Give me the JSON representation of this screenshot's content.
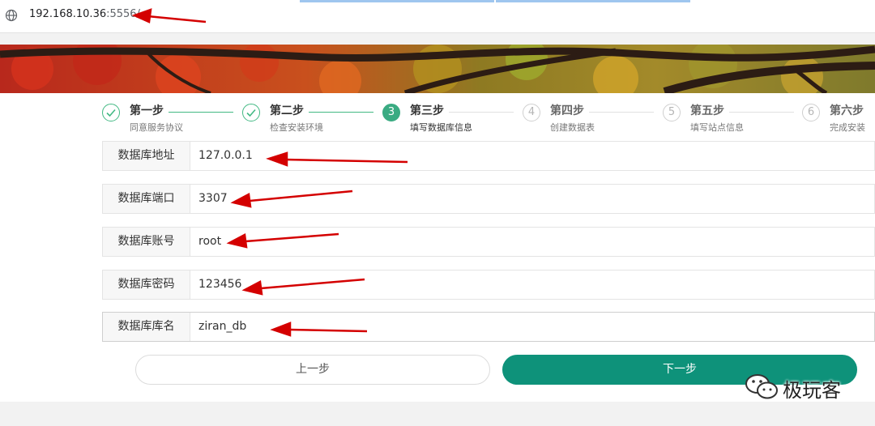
{
  "browser": {
    "url_host": "192.168.10.36",
    "url_rest": ":5556/"
  },
  "steps": [
    {
      "title": "第一步",
      "desc": "同意服务协议",
      "state": "done",
      "num": ""
    },
    {
      "title": "第二步",
      "desc": "检查安装环境",
      "state": "done",
      "num": ""
    },
    {
      "title": "第三步",
      "desc": "填写数据库信息",
      "state": "active",
      "num": "3"
    },
    {
      "title": "第四步",
      "desc": "创建数据表",
      "state": "todo",
      "num": "4"
    },
    {
      "title": "第五步",
      "desc": "填写站点信息",
      "state": "todo",
      "num": "5"
    },
    {
      "title": "第六步",
      "desc": "完成安装",
      "state": "todo",
      "num": "6"
    }
  ],
  "form": {
    "fields": [
      {
        "label": "数据库地址",
        "value": "127.0.0.1"
      },
      {
        "label": "数据库端口",
        "value": "3307"
      },
      {
        "label": "数据库账号",
        "value": "root"
      },
      {
        "label": "数据库密码",
        "value": "123456"
      },
      {
        "label": "数据库库名",
        "value": "ziran_db"
      }
    ]
  },
  "buttons": {
    "prev": "上一步",
    "next": "下一步"
  },
  "watermark": {
    "text": "极玩客"
  },
  "colors": {
    "accent": "#0e927a",
    "step_done": "#42b983",
    "arrow": "#d40000"
  }
}
